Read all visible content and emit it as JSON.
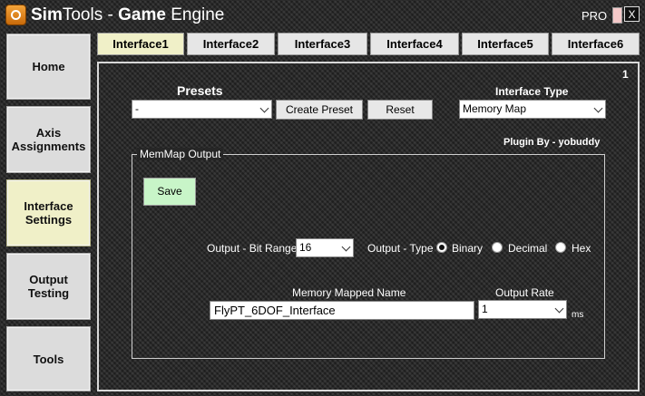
{
  "titlebar": {
    "app_name_part1": "Sim",
    "app_name_part2": "Tools - ",
    "app_name_part3": "Game",
    "app_name_part4": " Engine",
    "edition": "PRO",
    "close_label": "X"
  },
  "sidebar": {
    "items": [
      {
        "label": "Home"
      },
      {
        "label": "Axis Assignments"
      },
      {
        "label": "Interface Settings"
      },
      {
        "label": "Output Testing"
      },
      {
        "label": "Tools"
      }
    ]
  },
  "tabs": [
    {
      "label": "Interface1"
    },
    {
      "label": "Interface2"
    },
    {
      "label": "Interface3"
    },
    {
      "label": "Interface4"
    },
    {
      "label": "Interface5"
    },
    {
      "label": "Interface6"
    }
  ],
  "panel": {
    "number": "1",
    "presets_label": "Presets",
    "preset_value": "-",
    "create_preset_label": "Create Preset",
    "reset_label": "Reset",
    "interface_type_label": "Interface Type",
    "interface_type_value": "Memory Map",
    "plugin_by": "Plugin By - yobuddy",
    "group_title": "MemMap Output",
    "save_label": "Save",
    "bit_range_label": "Output - Bit Range",
    "bit_range_value": "16",
    "output_type_label": "Output - Type",
    "type_options": [
      {
        "label": "Binary",
        "checked": true
      },
      {
        "label": "Decimal",
        "checked": false
      },
      {
        "label": "Hex",
        "checked": false
      }
    ],
    "mapped_name_label": "Memory Mapped Name",
    "mapped_name_value": "FlyPT_6DOF_Interface",
    "output_rate_label": "Output Rate",
    "output_rate_value": "1",
    "output_rate_unit": "ms"
  },
  "colors": {
    "active_tab": "#f0f0c8",
    "save_button": "#c8f5c8",
    "logo": "#e88a20"
  }
}
